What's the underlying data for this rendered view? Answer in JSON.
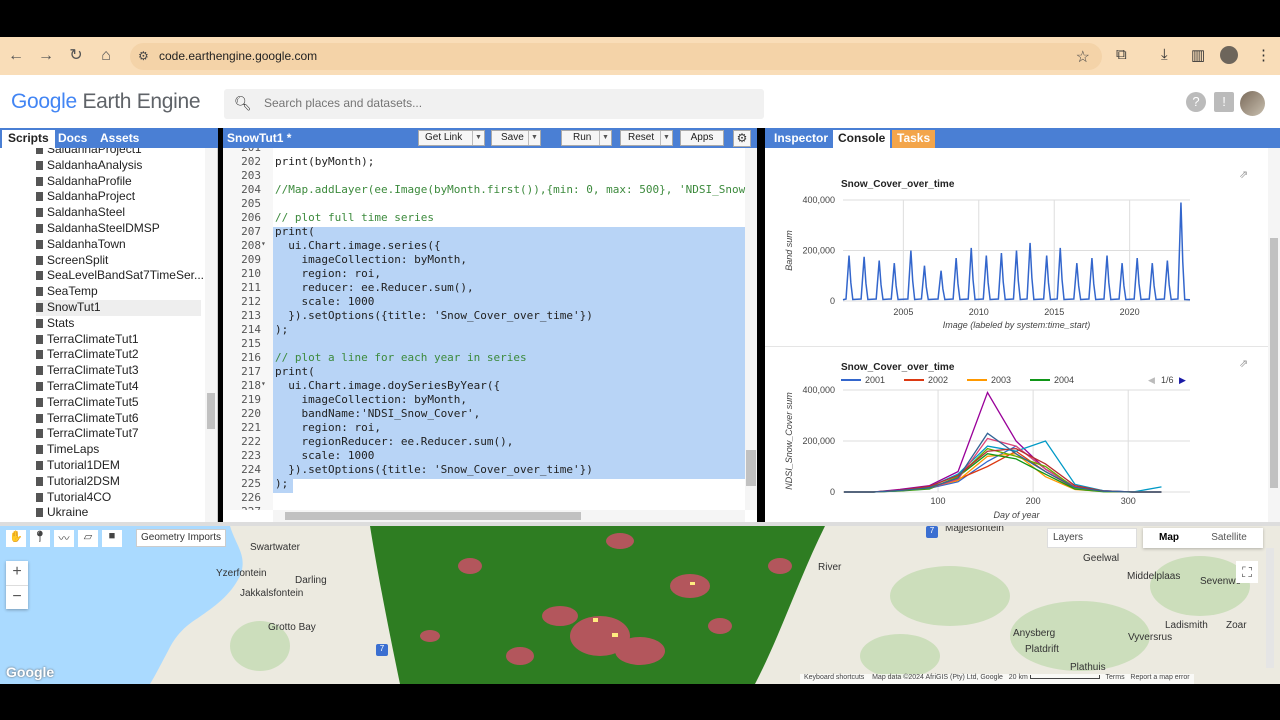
{
  "browser": {
    "url": "code.earthengine.google.com"
  },
  "app": {
    "logo_google": "Google",
    "logo_product": "Earth Engine",
    "search_placeholder": "Search places and datasets..."
  },
  "left_panel": {
    "tabs": [
      "Scripts",
      "Docs",
      "Assets"
    ],
    "scripts": [
      "SaldanhaProject1",
      "SaldanhaAnalysis",
      "SaldanhaProfile",
      "SaldanhaProject",
      "SaldanhaSteel",
      "SaldanhaSteelDMSP",
      "SaldanhaTown",
      "ScreenSplit",
      "SeaLevelBandSat7TimeSer...",
      "SeaTemp",
      "SnowTut1",
      "Stats",
      "TerraClimateTut1",
      "TerraClimateTut2",
      "TerraClimateTut3",
      "TerraClimateTut4",
      "TerraClimateTut5",
      "TerraClimateTut6",
      "TerraClimateTut7",
      "TimeLaps",
      "Tutorial1DEM",
      "Tutorial2DSM",
      "Tutorial4CO",
      "Ukraine"
    ]
  },
  "editor": {
    "file_title": "SnowTut1 *",
    "buttons": {
      "get_link": "Get Link",
      "save": "Save",
      "run": "Run",
      "reset": "Reset",
      "apps": "Apps"
    },
    "lines": [
      {
        "n": "201",
        "text": ""
      },
      {
        "n": "202",
        "text": "print(byMonth);"
      },
      {
        "n": "203",
        "text": ""
      },
      {
        "n": "204",
        "text": "//Map.addLayer(ee.Image(byMonth.first()),{min: 0, max: 500}, 'NDSI_Snow_"
      },
      {
        "n": "205",
        "text": ""
      },
      {
        "n": "206",
        "text": "// plot full time series"
      },
      {
        "n": "207",
        "text": "print("
      },
      {
        "n": "208",
        "text": "  ui.Chart.image.series({"
      },
      {
        "n": "209",
        "text": "    imageCollection: byMonth,"
      },
      {
        "n": "210",
        "text": "    region: roi,"
      },
      {
        "n": "211",
        "text": "    reducer: ee.Reducer.sum(),"
      },
      {
        "n": "212",
        "text": "    scale: 1000"
      },
      {
        "n": "213",
        "text": "  }).setOptions({title: 'Snow_Cover_over_time'})"
      },
      {
        "n": "214",
        "text": ");"
      },
      {
        "n": "215",
        "text": ""
      },
      {
        "n": "216",
        "text": "// plot a line for each year in series"
      },
      {
        "n": "217",
        "text": "print("
      },
      {
        "n": "218",
        "text": "  ui.Chart.image.doySeriesByYear({"
      },
      {
        "n": "219",
        "text": "    imageCollection: byMonth,"
      },
      {
        "n": "220",
        "text": "    bandName:'NDSI_Snow_Cover',"
      },
      {
        "n": "221",
        "text": "    region: roi,"
      },
      {
        "n": "222",
        "text": "    regionReducer: ee.Reducer.sum(),"
      },
      {
        "n": "223",
        "text": "    scale: 1000"
      },
      {
        "n": "224",
        "text": "  }).setOptions({title: 'Snow_Cover_over_time'})"
      },
      {
        "n": "225",
        "text": ");"
      },
      {
        "n": "226",
        "text": ""
      },
      {
        "n": "227",
        "text": ""
      }
    ]
  },
  "right_panel": {
    "tabs": [
      "Inspector",
      "Console",
      "Tasks"
    ]
  },
  "chart_data": [
    {
      "type": "line",
      "title": "Snow_Cover_over_time",
      "xlabel": "Image (labeled by system:time_start)",
      "ylabel": "Band sum",
      "x_ticks": [
        "2005",
        "2010",
        "2015",
        "2020"
      ],
      "y_ticks": [
        "400,000",
        "200,000",
        "0"
      ],
      "ylim": [
        0,
        400000
      ],
      "xlim": [
        2001,
        2024
      ],
      "series": [
        {
          "peaks": [
            [
              2001.4,
              180000
            ],
            [
              2002.4,
              175000
            ],
            [
              2003.4,
              160000
            ],
            [
              2004.4,
              150000
            ],
            [
              2005.5,
              200000
            ],
            [
              2006.4,
              140000
            ],
            [
              2007.5,
              120000
            ],
            [
              2008.5,
              170000
            ],
            [
              2009.5,
              210000
            ],
            [
              2010.5,
              180000
            ],
            [
              2011.5,
              190000
            ],
            [
              2012.5,
              200000
            ],
            [
              2013.4,
              230000
            ],
            [
              2014.5,
              180000
            ],
            [
              2015.4,
              210000
            ],
            [
              2016.5,
              150000
            ],
            [
              2017.5,
              170000
            ],
            [
              2018.5,
              180000
            ],
            [
              2019.5,
              150000
            ],
            [
              2020.5,
              170000
            ],
            [
              2021.5,
              150000
            ],
            [
              2022.5,
              160000
            ],
            [
              2023.4,
              390000
            ]
          ]
        }
      ],
      "legend": "none",
      "grid": true
    },
    {
      "type": "line",
      "title": "Snow_Cover_over_time",
      "xlabel": "Day of year",
      "ylabel": "NDSI_Snow_Cover sum",
      "x_ticks": [
        "100",
        "200",
        "300"
      ],
      "y_ticks": [
        "400,000",
        "200,000",
        "0"
      ],
      "ylim": [
        0,
        400000
      ],
      "xlim": [
        0,
        365
      ],
      "legend_position": "top",
      "legend_page": "1/6",
      "series": [
        {
          "name": "2001",
          "color": "#3366cc",
          "x": [
            1,
            32,
            60,
            91,
            121,
            152,
            182,
            213,
            244,
            274,
            305,
            335
          ],
          "y": [
            0,
            0,
            5000,
            15000,
            40000,
            120000,
            180000,
            90000,
            20000,
            5000,
            0,
            0
          ]
        },
        {
          "name": "2002",
          "color": "#dc3912",
          "x": [
            1,
            32,
            60,
            91,
            121,
            152,
            182,
            213,
            244,
            274,
            305,
            335
          ],
          "y": [
            0,
            0,
            8000,
            20000,
            50000,
            100000,
            160000,
            80000,
            15000,
            3000,
            0,
            0
          ]
        },
        {
          "name": "2003",
          "color": "#ff9900",
          "x": [
            1,
            32,
            60,
            91,
            121,
            152,
            182,
            213,
            244,
            274,
            305,
            335
          ],
          "y": [
            0,
            0,
            6000,
            18000,
            45000,
            140000,
            150000,
            60000,
            10000,
            2000,
            0,
            0
          ]
        },
        {
          "name": "2004",
          "color": "#109618",
          "x": [
            1,
            32,
            60,
            91,
            121,
            152,
            182,
            213,
            244,
            274,
            305,
            335
          ],
          "y": [
            0,
            0,
            4000,
            12000,
            60000,
            150000,
            130000,
            70000,
            12000,
            1000,
            0,
            0
          ]
        },
        {
          "color": "#990099",
          "x": [
            1,
            32,
            60,
            91,
            121,
            152,
            182,
            213,
            244,
            274,
            305,
            335
          ],
          "y": [
            0,
            0,
            10000,
            25000,
            80000,
            390000,
            200000,
            90000,
            20000,
            5000,
            0,
            0
          ]
        },
        {
          "color": "#0099c6",
          "x": [
            1,
            32,
            60,
            91,
            121,
            152,
            182,
            213,
            244,
            274,
            305,
            335
          ],
          "y": [
            0,
            0,
            5000,
            20000,
            70000,
            180000,
            160000,
            200000,
            30000,
            5000,
            0,
            20000
          ]
        },
        {
          "color": "#dd4477",
          "x": [
            1,
            32,
            60,
            91,
            121,
            152,
            182,
            213,
            244,
            274,
            305,
            335
          ],
          "y": [
            0,
            0,
            6000,
            15000,
            50000,
            210000,
            180000,
            90000,
            20000,
            3000,
            0,
            0
          ]
        },
        {
          "color": "#66aa00",
          "x": [
            1,
            32,
            60,
            91,
            121,
            152,
            182,
            213,
            244,
            274,
            305,
            335
          ],
          "y": [
            0,
            0,
            5000,
            14000,
            60000,
            170000,
            140000,
            100000,
            15000,
            2000,
            0,
            0
          ]
        },
        {
          "color": "#b82e2e",
          "x": [
            1,
            32,
            60,
            91,
            121,
            152,
            182,
            213,
            244,
            274,
            305,
            335
          ],
          "y": [
            0,
            0,
            7000,
            22000,
            65000,
            160000,
            170000,
            110000,
            25000,
            4000,
            0,
            0
          ]
        },
        {
          "color": "#316395",
          "x": [
            1,
            32,
            60,
            91,
            121,
            152,
            182,
            213,
            244,
            274,
            305,
            335
          ],
          "y": [
            0,
            0,
            6000,
            16000,
            55000,
            230000,
            150000,
            80000,
            18000,
            3000,
            0,
            0
          ]
        }
      ]
    }
  ],
  "map": {
    "toolbar": {
      "geometry_imports": "Geometry Imports"
    },
    "controls": {
      "layers": "Layers",
      "map": "Map",
      "satellite": "Satellite",
      "zoom_in": "+",
      "zoom_out": "−"
    },
    "places": [
      "Swartwater",
      "Yzerfontein",
      "Darling",
      "Jakkalsfontein",
      "Grotto Bay",
      "Majjesfontein",
      "River",
      "Geelwal",
      "Middelplaas",
      "Sevenweeks Poort",
      "Ladismith",
      "Zoar",
      "Anysberg",
      "Vyversrus",
      "Platdrift",
      "Plathuis"
    ],
    "attribution": {
      "keyboard": "Keyboard shortcuts",
      "data": "Map data ©2024 AfriGIS (Pty) Ltd, Google",
      "scale": "20 km",
      "terms": "Terms",
      "report": "Report a map error"
    },
    "google": "Google",
    "route_badges": [
      "7",
      "7"
    ]
  }
}
